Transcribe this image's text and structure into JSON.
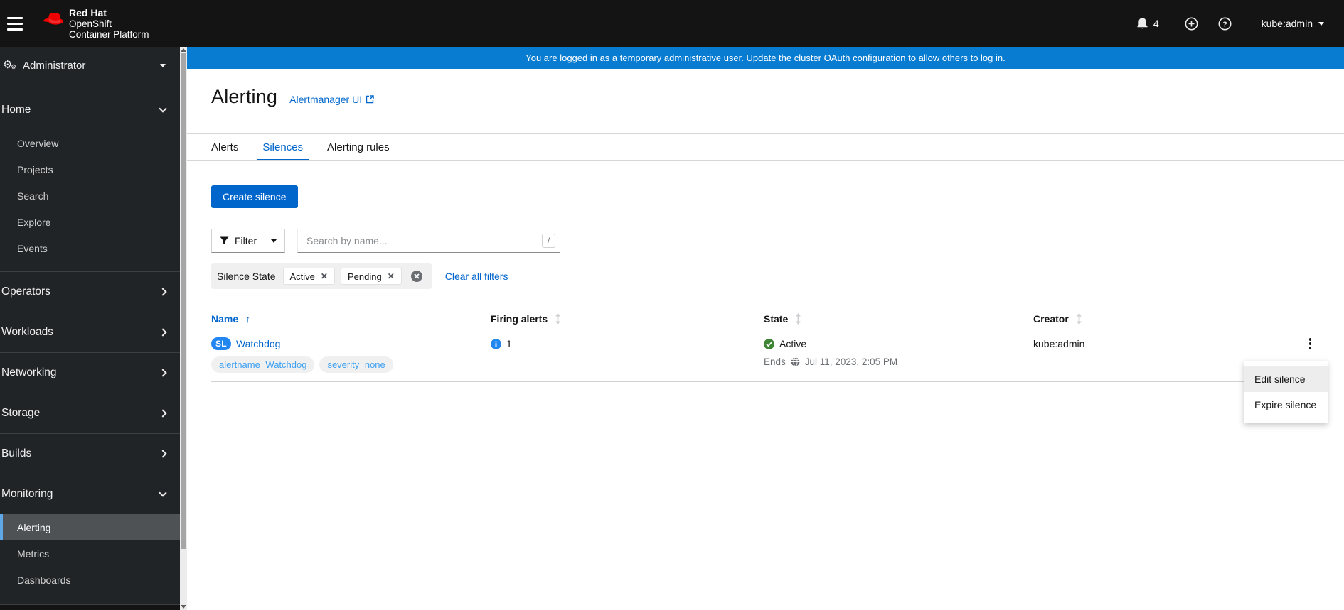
{
  "masthead": {
    "logo_line1": "Red Hat",
    "logo_line2": "OpenShift",
    "logo_line3": "Container Platform",
    "notification_count": "4",
    "username": "kube:admin"
  },
  "banner": {
    "text_before": "You are logged in as a temporary administrative user. Update the ",
    "link_text": "cluster OAuth configuration",
    "text_after": " to allow others to log in."
  },
  "sidebar": {
    "perspective": "Administrator",
    "home": {
      "label": "Home",
      "items": [
        "Overview",
        "Projects",
        "Search",
        "Explore",
        "Events"
      ]
    },
    "sections": [
      "Operators",
      "Workloads",
      "Networking",
      "Storage",
      "Builds"
    ],
    "monitoring": {
      "label": "Monitoring",
      "items": [
        "Alerting",
        "Metrics",
        "Dashboards"
      ],
      "active_item": "Alerting"
    }
  },
  "page": {
    "title": "Alerting",
    "subtitle_link": "Alertmanager UI",
    "tabs": {
      "t0": "Alerts",
      "t1": "Silences",
      "t2": "Alerting rules"
    },
    "create_button": "Create silence",
    "toolbar": {
      "filter_label": "Filter",
      "search_placeholder": "Search by name...",
      "search_shortcut": "/"
    },
    "chips": {
      "group_label": "Silence State",
      "chip0": "Active",
      "chip1": "Pending",
      "clear_label": "Clear all filters"
    },
    "table": {
      "columns": {
        "c0": "Name",
        "c1": "Firing alerts",
        "c2": "State",
        "c3": "Creator"
      },
      "row": {
        "badge": "SL",
        "name": "Watchdog",
        "label0": "alertname=Watchdog",
        "label1": "severity=none",
        "firing_count": "1",
        "state": "Active",
        "ends_prefix": "Ends",
        "ends_value": "Jul 11, 2023, 2:05 PM",
        "creator": "kube:admin"
      }
    },
    "menu": {
      "item0": "Edit silence",
      "item1": "Expire silence"
    }
  },
  "colors": {
    "primary_blue": "#0066cc",
    "banner_blue": "#087cd1",
    "masthead_black": "#141414",
    "nav_bg": "#212427",
    "nav_active_bg": "#4f5255",
    "nav_active_indicator": "#5fa8e8",
    "success_green": "#3e8635",
    "info_blue": "#2186f0",
    "label_chip_blue": "#3da0f2",
    "muted_gray": "#6a6e73",
    "border_gray": "#d2d2d2"
  }
}
